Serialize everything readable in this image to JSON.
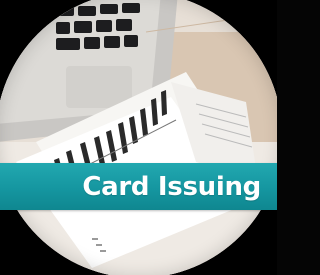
{
  "caption": {
    "label": "Card Issuing"
  },
  "photo": {
    "subject": "laptop-and-bar-chart-papers-icon"
  },
  "colors": {
    "background": "#050505",
    "band": "#1596a0",
    "caption_text": "#ffffff",
    "desk": "#e9e2da"
  }
}
